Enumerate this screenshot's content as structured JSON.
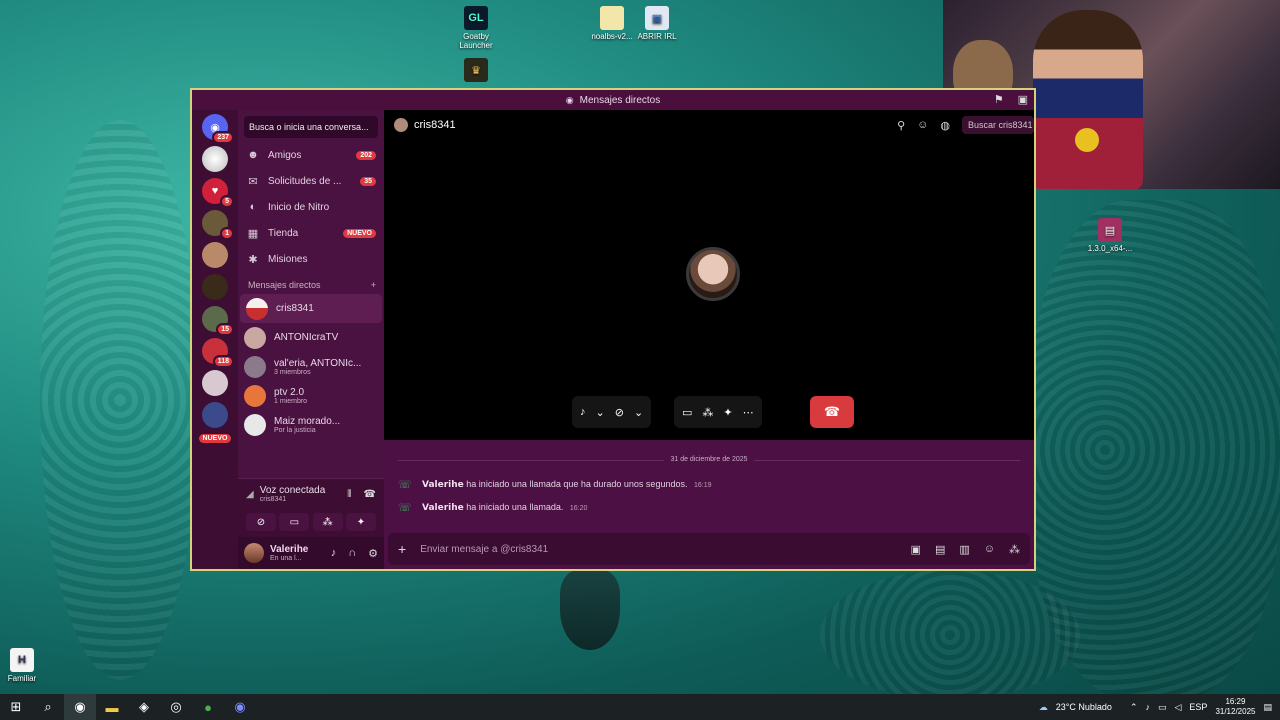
{
  "desktop": {
    "icons": [
      {
        "label": "Goatby Launcher",
        "glyph": "GL"
      },
      {
        "label": "noalbs-v2...",
        "glyph": ""
      },
      {
        "label": "ABRIR IRL",
        "glyph": ""
      },
      {
        "label": "1.3.0_x64-...",
        "glyph": ""
      },
      {
        "label": "Familiar",
        "glyph": "H"
      }
    ]
  },
  "window": {
    "title": "Mensajes directos",
    "servers": [
      {
        "badge": "237"
      },
      {
        "badge": ""
      },
      {
        "badge": "5"
      },
      {
        "badge": "1"
      },
      {
        "badge": ""
      },
      {
        "badge": ""
      },
      {
        "badge": "15"
      },
      {
        "badge": "118"
      },
      {
        "badge": ""
      }
    ],
    "rail_new": "NUEVO",
    "search_placeholder": "Busca o inicia una conversa...",
    "nav": [
      {
        "label": "Amigos",
        "count": "202"
      },
      {
        "label": "Solicitudes de ...",
        "count": "35"
      },
      {
        "label": "Inicio de Nitro",
        "count": ""
      },
      {
        "label": "Tienda",
        "count": "NUEVO"
      },
      {
        "label": "Misiones",
        "count": ""
      }
    ],
    "dm_header": "Mensajes directos",
    "dms": [
      {
        "name": "cris8341",
        "sub": ""
      },
      {
        "name": "ANTONIcraTV",
        "sub": ""
      },
      {
        "name": "val'eria, ANTONIc...",
        "sub": "3 miembros"
      },
      {
        "name": "ptv 2.0",
        "sub": "1 miembro"
      },
      {
        "name": "Maiz morado...",
        "sub": "Por la justicia"
      }
    ],
    "voice": {
      "title": "Voz conectada",
      "channel": "cris8341"
    },
    "user": {
      "name": "Valerihe",
      "status": "En una l..."
    },
    "call": {
      "peer": "cris8341",
      "search": "Buscar cris8341"
    },
    "chat": {
      "date": "31 de diciembre de 2025",
      "messages": [
        {
          "who": "Valerihe",
          "text": "ha iniciado una llamada que ha durado unos segundos.",
          "time": "16:19"
        },
        {
          "who": "Valerihe",
          "text": "ha iniciado una llamada.",
          "time": "16:20"
        }
      ],
      "placeholder": "Enviar mensaje a @cris8341"
    }
  },
  "taskbar": {
    "weather": "23°C  Nublado",
    "lang": "ESP",
    "time": "16:29",
    "date": "31/12/2025"
  }
}
